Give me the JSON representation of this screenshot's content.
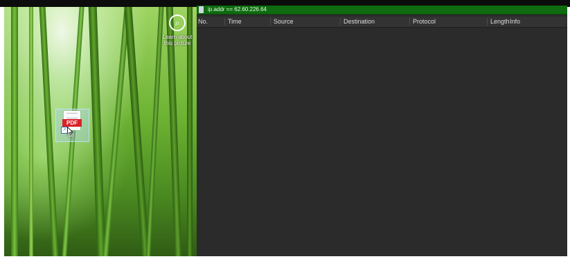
{
  "desktop": {
    "learn_about": "Learn about this picture",
    "pdf_file": {
      "badge": "PDF",
      "label": "file"
    }
  },
  "wireshark": {
    "filter_text": "ip.addr == 62.60.226.64",
    "filter_bar_color": "#0f6b0f",
    "columns": [
      "No.",
      "Time",
      "Source",
      "Destination",
      "Protocol",
      "Length",
      "Info"
    ]
  }
}
